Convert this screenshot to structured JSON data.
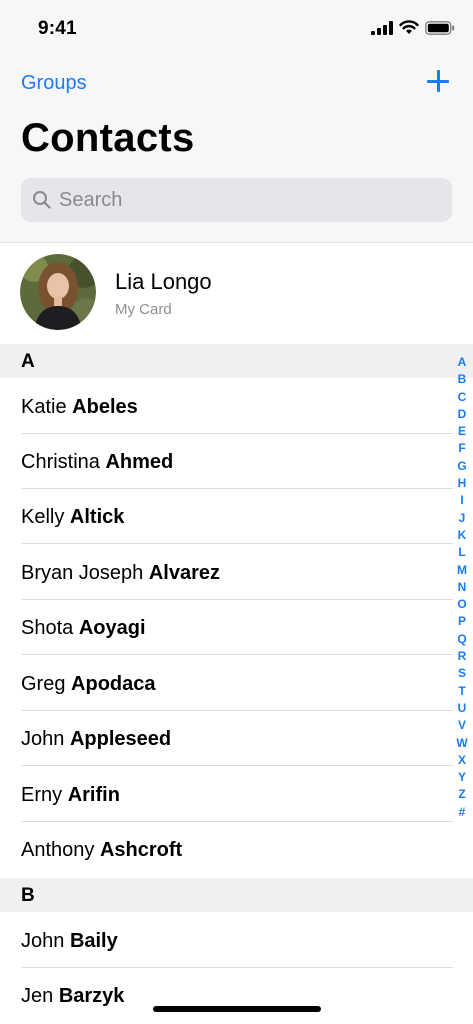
{
  "status_bar": {
    "time": "9:41"
  },
  "nav": {
    "groups_label": "Groups",
    "add_icon": "plus-icon"
  },
  "title": "Contacts",
  "search": {
    "placeholder": "Search",
    "value": ""
  },
  "my_card": {
    "name": "Lia Longo",
    "subtitle": "My Card"
  },
  "sections": [
    {
      "letter": "A",
      "contacts": [
        {
          "first": "Katie",
          "last": "Abeles"
        },
        {
          "first": "Christina",
          "last": "Ahmed"
        },
        {
          "first": "Kelly",
          "last": "Altick"
        },
        {
          "first": "Bryan Joseph",
          "last": "Alvarez"
        },
        {
          "first": "Shota",
          "last": "Aoyagi"
        },
        {
          "first": "Greg",
          "last": "Apodaca"
        },
        {
          "first": "John",
          "last": "Appleseed"
        },
        {
          "first": "Erny",
          "last": "Arifin"
        },
        {
          "first": "Anthony",
          "last": "Ashcroft"
        }
      ]
    },
    {
      "letter": "B",
      "contacts": [
        {
          "first": "John",
          "last": "Baily"
        },
        {
          "first": "Jen",
          "last": "Barzyk"
        }
      ]
    }
  ],
  "index_letters": [
    "A",
    "B",
    "C",
    "D",
    "E",
    "F",
    "G",
    "H",
    "I",
    "J",
    "K",
    "L",
    "M",
    "N",
    "O",
    "P",
    "Q",
    "R",
    "S",
    "T",
    "U",
    "V",
    "W",
    "X",
    "Y",
    "Z",
    "#"
  ],
  "colors": {
    "accent": "#1a7cf0",
    "header_bg": "#f7f7f8",
    "section_bg": "#f0f0f2"
  }
}
